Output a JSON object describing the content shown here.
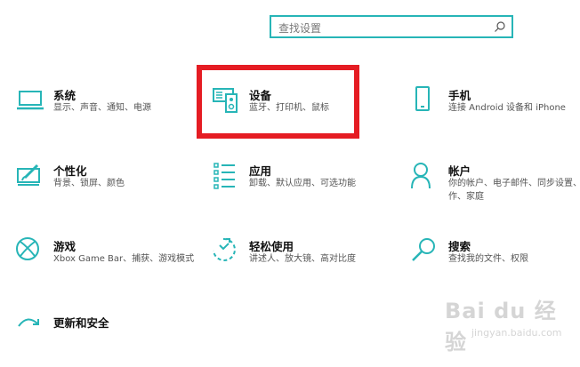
{
  "search": {
    "placeholder": "查找设置"
  },
  "tiles": [
    {
      "title": "系统",
      "desc": "显示、声音、通知、电源",
      "icon": "laptop-icon"
    },
    {
      "title": "设备",
      "desc": "蓝牙、打印机、鼠标",
      "icon": "keyboard-speaker-icon"
    },
    {
      "title": "手机",
      "desc": "连接 Android 设备和 iPhone",
      "icon": "phone-icon"
    },
    {
      "title": "个性化",
      "desc": "背景、锁屏、颜色",
      "icon": "paint-monitor-icon"
    },
    {
      "title": "应用",
      "desc": "卸载、默认应用、可选功能",
      "icon": "apps-list-icon"
    },
    {
      "title": "帐户",
      "desc": "你的帐户、电子邮件、同步设置、工作、家庭",
      "icon": "person-icon"
    },
    {
      "title": "游戏",
      "desc": "Xbox Game Bar、捕获、游戏模式",
      "icon": "xbox-icon"
    },
    {
      "title": "轻松使用",
      "desc": "讲述人、放大镜、高对比度",
      "icon": "ease-of-access-icon"
    },
    {
      "title": "搜索",
      "desc": "查找我的文件、权限",
      "icon": "search-icon"
    },
    {
      "title": "更新和安全",
      "desc": "",
      "icon": "update-icon"
    }
  ],
  "watermark": {
    "brand": "Bai du 经验",
    "url": "jingyan.baidu.com"
  },
  "colors": {
    "accent": "#27b5b7",
    "highlight": "#e51c23"
  }
}
